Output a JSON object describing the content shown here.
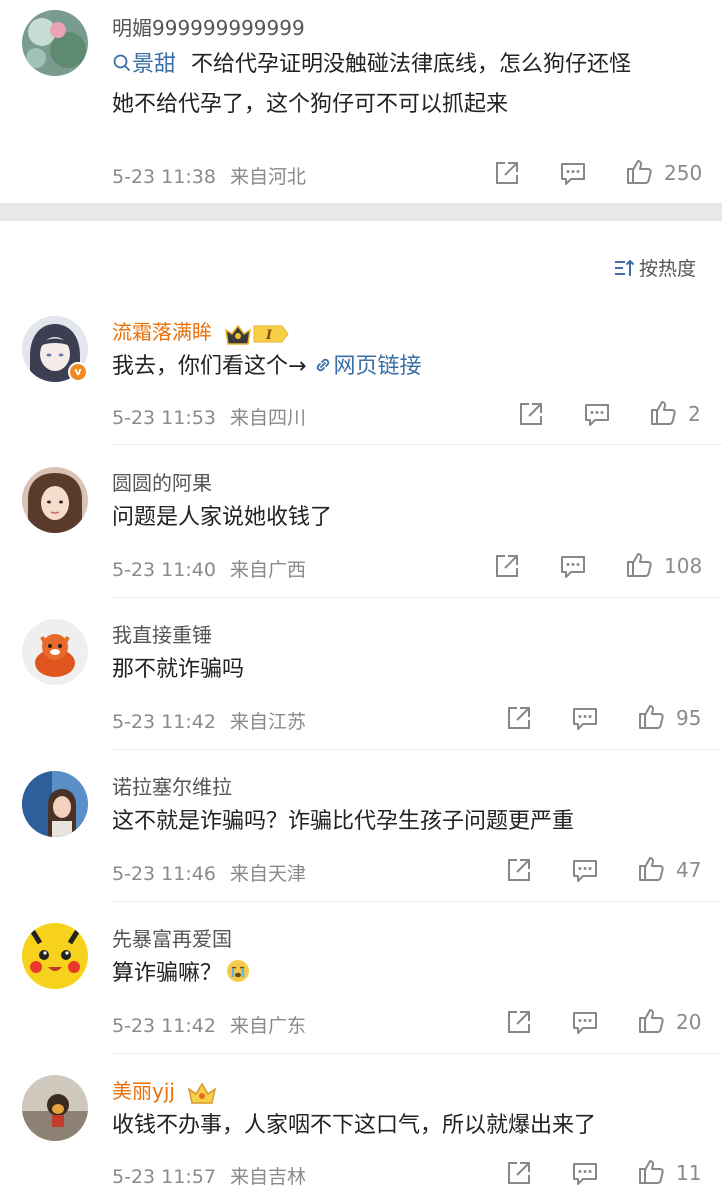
{
  "top_comment": {
    "username": "明媚999999999999",
    "mention": "景甜",
    "text_line1": "不给代孕证明没触碰法律底线，怎么狗仔还怪",
    "text_line2": "她不给代孕了，这个狗仔可不可以抓起来",
    "time": "5-23 11:38",
    "location": "来自河北",
    "likes": "250"
  },
  "sort": {
    "label": "按热度"
  },
  "comments": [
    {
      "username": "流霜落满眸",
      "text": "我去，你们看这个→",
      "link_text": "网页链接",
      "time": "5-23 11:53",
      "location": "来自四川",
      "likes": "2",
      "vip_level": "I"
    },
    {
      "username": "圆圆的阿果",
      "text": "问题是人家说她收钱了",
      "time": "5-23 11:40",
      "location": "来自广西",
      "likes": "108"
    },
    {
      "username": "我直接重锤",
      "text": "那不就诈骗吗",
      "time": "5-23 11:42",
      "location": "来自江苏",
      "likes": "95"
    },
    {
      "username": "诺拉塞尔维拉",
      "text": "这不就是诈骗吗？诈骗比代孕生孩子问题更严重",
      "time": "5-23 11:46",
      "location": "来自天津",
      "likes": "47"
    },
    {
      "username": "先暴富再爱国",
      "text": "算诈骗嘛？",
      "time": "5-23 11:42",
      "location": "来自广东",
      "likes": "20",
      "emoji": "crying-face-icon"
    },
    {
      "username": "美丽yjj",
      "text": "收钱不办事，人家咽不下这口气，所以就爆出来了",
      "time": "5-23 11:57",
      "location": "来自吉林",
      "likes": "11"
    }
  ],
  "colors": {
    "vip_name": "#e8720c",
    "link": "#3b6fa8",
    "meta": "#8a8a8a",
    "band": "#e9e9e9"
  }
}
